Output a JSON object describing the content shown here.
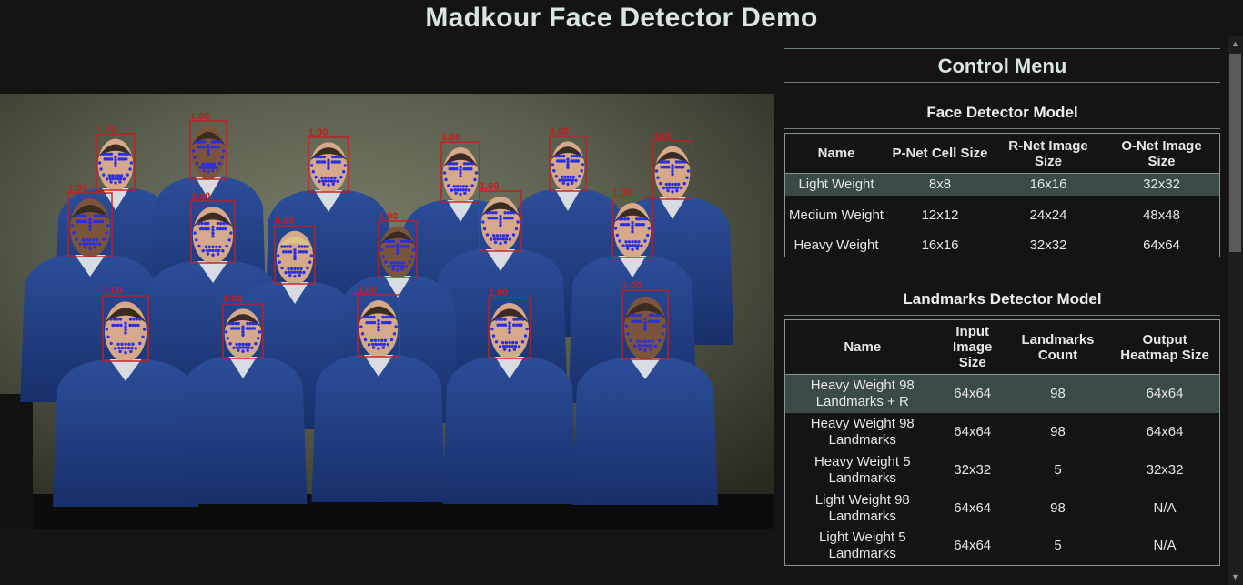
{
  "app": {
    "title": "Madkour Face Detector Demo"
  },
  "photo": {
    "detections": [
      {
        "score": "1.00"
      },
      {
        "score": "1.00"
      },
      {
        "score": "1.00"
      },
      {
        "score": "1.00"
      },
      {
        "score": "1.00"
      },
      {
        "score": "1.00"
      },
      {
        "score": "1.00"
      },
      {
        "score": "1.00"
      },
      {
        "score": "1.00"
      },
      {
        "score": "1.00"
      },
      {
        "score": "0.98"
      },
      {
        "score": "1.00"
      },
      {
        "score": "1.00"
      },
      {
        "score": "1.00"
      },
      {
        "score": "1.00"
      },
      {
        "score": "1.00"
      },
      {
        "score": "1.00"
      },
      {
        "score": "1.00"
      }
    ],
    "colors": {
      "box": "#c41e1e",
      "landmark": "#2a2fe0",
      "suit": "#233f85"
    }
  },
  "control_menu": {
    "title": "Control Menu",
    "face_detector": {
      "title": "Face Detector Model",
      "headers": [
        "Name",
        "P-Net Cell Size",
        "R-Net Image Size",
        "O-Net Image Size"
      ],
      "rows": [
        {
          "name": "Light Weight",
          "pnet": "8x8",
          "rnet": "16x16",
          "onet": "32x32",
          "selected": true
        },
        {
          "name": "Medium Weight",
          "pnet": "12x12",
          "rnet": "24x24",
          "onet": "48x48",
          "selected": false
        },
        {
          "name": "Heavy Weight",
          "pnet": "16x16",
          "rnet": "32x32",
          "onet": "64x64",
          "selected": false
        }
      ]
    },
    "landmarks_detector": {
      "title": "Landmarks Detector Model",
      "headers": [
        "Name",
        "Input Image Size",
        "Landmarks Count",
        "Output Heatmap Size"
      ],
      "rows": [
        {
          "name": "Heavy Weight 98 Landmarks + R",
          "input": "64x64",
          "count": "98",
          "heatmap": "64x64",
          "selected": true
        },
        {
          "name": "Heavy Weight 98 Landmarks",
          "input": "64x64",
          "count": "98",
          "heatmap": "64x64",
          "selected": false
        },
        {
          "name": "Heavy Weight 5 Landmarks",
          "input": "32x32",
          "count": "5",
          "heatmap": "32x32",
          "selected": false
        },
        {
          "name": "Light Weight 98 Landmarks",
          "input": "64x64",
          "count": "98",
          "heatmap": "N/A",
          "selected": false
        },
        {
          "name": "Light Weight 5 Landmarks",
          "input": "64x64",
          "count": "5",
          "heatmap": "N/A",
          "selected": false
        }
      ]
    }
  }
}
